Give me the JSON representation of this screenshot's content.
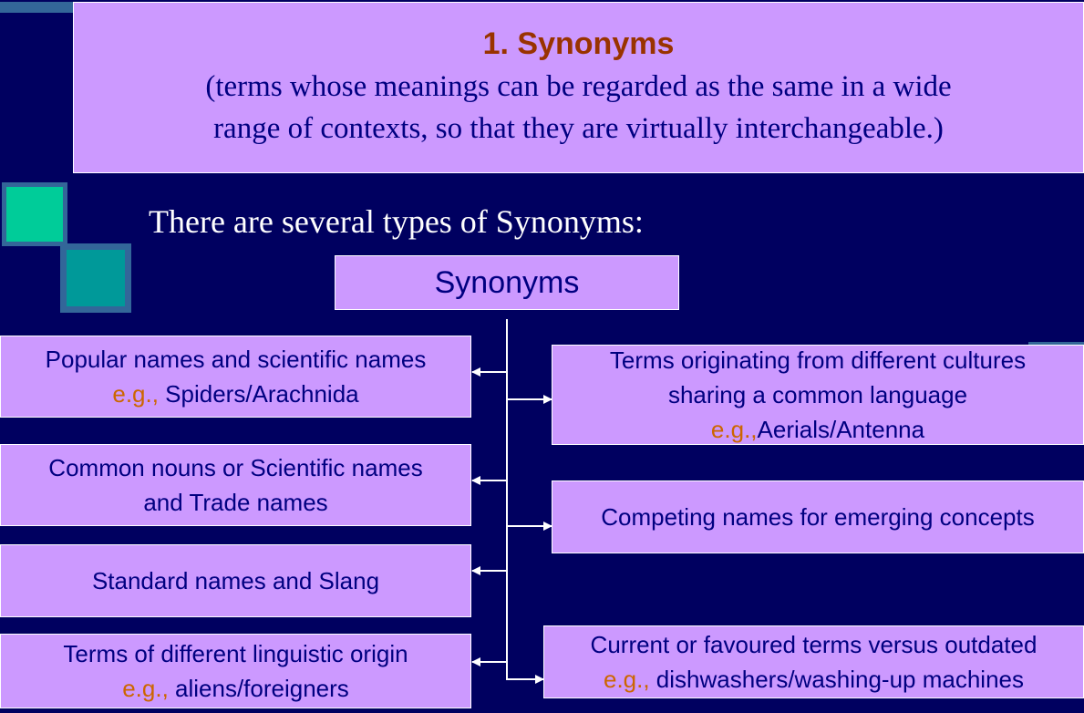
{
  "header": {
    "title": "1. Synonyms",
    "definition_line1": "(terms whose meanings can be regarded as the same in a wide",
    "definition_line2": "range of contexts, so that they are virtually interchangeable.)"
  },
  "intro": "There are several types of Synonyms:",
  "root": {
    "label": "Synonyms"
  },
  "left_nodes": [
    {
      "line1": "Popular names  and scientific names",
      "eg": "e.g.,",
      "example": " Spiders/Arachnida"
    },
    {
      "line1": "Common nouns or Scientific names",
      "line2": "and Trade names"
    },
    {
      "line1": "Standard names and Slang"
    },
    {
      "line1": "Terms of different  linguistic origin",
      "eg": "e.g.,",
      "example": " aliens/foreigners"
    }
  ],
  "right_nodes": [
    {
      "line1": "Terms originating from different  cultures",
      "line2": "sharing a common language",
      "eg": "e.g.,",
      "example": "Aerials/Antenna"
    },
    {
      "line1": "Competing names for emerging concepts"
    },
    {
      "line1": "Current or favoured terms versus outdated",
      "eg": "e.g.,",
      "example": " dishwashers/washing-up machines"
    }
  ],
  "colors": {
    "background": "#000060",
    "box_fill": "#cc99ff",
    "text": "#000080",
    "title": "#993300",
    "example_marker": "#cc6600",
    "deco_square_1": "#00cc99",
    "deco_square_2": "#009999"
  }
}
